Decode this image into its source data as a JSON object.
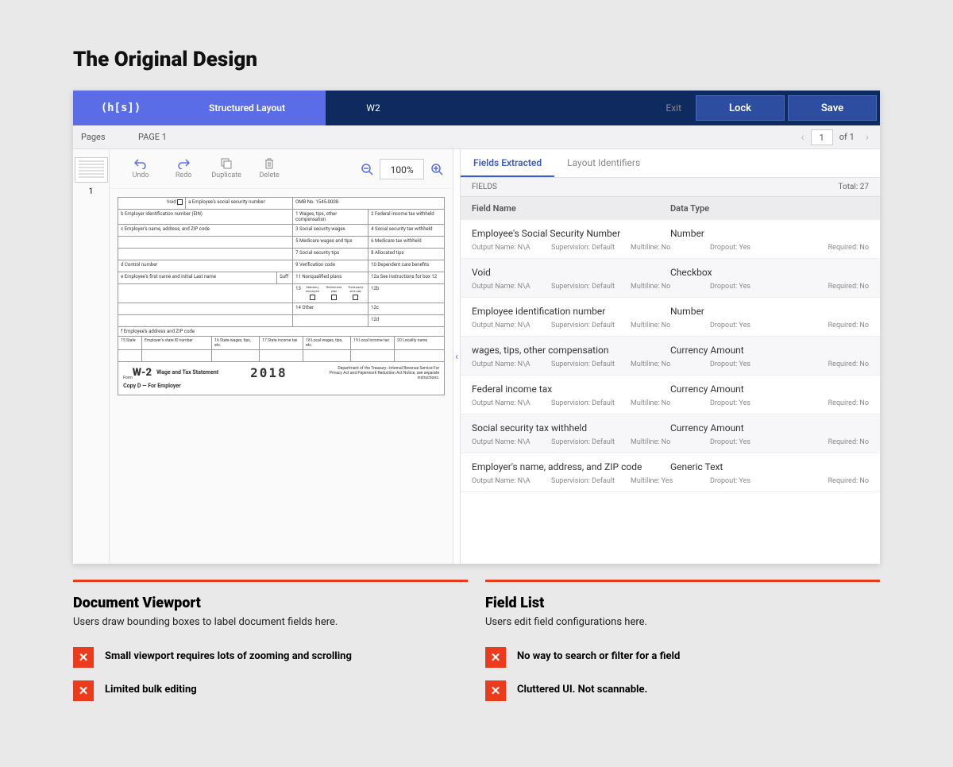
{
  "title": "The Original Design",
  "header": {
    "logo": "(h[s])",
    "tab_sl": "Structured Layout",
    "tab_w2": "W2",
    "exit": "Exit",
    "lock": "Lock",
    "save": "Save"
  },
  "subheader": {
    "pages": "Pages",
    "page1": "PAGE 1",
    "page_num": "1",
    "of": "of 1"
  },
  "sidebar": {
    "thumb_num": "1"
  },
  "toolbar": {
    "undo": "Undo",
    "redo": "Redo",
    "duplicate": "Duplicate",
    "delete": "Delete",
    "zoom": "100%"
  },
  "w2": {
    "void": "Void",
    "a": "a  Employee's social security number",
    "omb": "OMB No. 1545-0008",
    "b": "b  Employer identification number (EIN)",
    "c": "c  Employer's name, address, and ZIP code",
    "d": "d  Control number",
    "e": "e  Employee's first name and initial    Last name",
    "suff": "Suff",
    "f": "f  Employee's address and ZIP code",
    "box1": "1  Wages, tips, other compensation",
    "box2": "2  Federal income tax withheld",
    "box3": "3  Social security wages",
    "box4": "4  Social security tax withheld",
    "box5": "5  Medicare wages and tips",
    "box6": "6  Medicare tax withheld",
    "box7": "7  Social security tips",
    "box8": "8  Allocated tips",
    "box9": "9  Verification code",
    "box10": "10  Dependent care benefits",
    "box11": "11  Nonqualified plans",
    "box12a": "12a  See instructions for box 12",
    "box12b": "12b",
    "box12c": "12c",
    "box12d": "12d",
    "box13a": "Statutory employee",
    "box13b": "Retirement plan",
    "box13c": "Third-party sick pay",
    "box13": "13",
    "box14": "14  Other",
    "box15": "15  State",
    "box15b": "Employer's state ID number",
    "box16": "16  State wages, tips, etc.",
    "box17": "17  State income tax",
    "box18": "18  Local wages, tips, etc.",
    "box19": "19  Local income tax",
    "box20": "20  Locality name",
    "form_small": "Form",
    "form": "W-2",
    "stmt": "Wage and Tax\nStatement",
    "year": "2018",
    "dept": "Department of the Treasury—Internal Revenue Service\nFor Privacy Act and Paperwork Reduction\nAct Notice, see separate instructions.",
    "copy": "Copy D — For Employer"
  },
  "panel": {
    "tab_fields": "Fields Extracted",
    "tab_layout": "Layout Identifiers",
    "fields_label": "FIELDS",
    "total": "Total: 27",
    "col_name": "Field Name",
    "col_type": "Data Type",
    "out_lbl": "Output Name:",
    "sup_lbl": "Supervision:",
    "mul_lbl": "Multiline:",
    "drop_lbl": "Dropout:",
    "req_lbl": "Required:",
    "rows": [
      {
        "name": "Employee's Social Security Number",
        "type": "Number",
        "out": "N\\A",
        "sup": "Default",
        "mul": "No",
        "drop": "Yes",
        "req": "No"
      },
      {
        "name": "Void",
        "type": "Checkbox",
        "out": "N\\A",
        "sup": "Default",
        "mul": "No",
        "drop": "Yes",
        "req": "No"
      },
      {
        "name": "Employee identification number",
        "type": "Number",
        "out": "N\\A",
        "sup": "Default",
        "mul": "No",
        "drop": "Yes",
        "req": "No"
      },
      {
        "name": "wages, tips, other compensation",
        "type": "Currency Amount",
        "out": "N\\A",
        "sup": "Default",
        "mul": "No",
        "drop": "Yes",
        "req": "No"
      },
      {
        "name": "Federal income tax",
        "type": "Currency Amount",
        "out": "N\\A",
        "sup": "Default",
        "mul": "No",
        "drop": "Yes",
        "req": "No"
      },
      {
        "name": "Social security tax withheld",
        "type": "Currency Amount",
        "out": "N\\A",
        "sup": "Default",
        "mul": "No",
        "drop": "Yes",
        "req": "No"
      },
      {
        "name": "Employer's name, address, and ZIP code",
        "type": "Generic Text",
        "out": "N\\A",
        "sup": "Default",
        "mul": "Yes",
        "drop": "Yes",
        "req": "No"
      }
    ]
  },
  "annotations": {
    "left": {
      "title": "Document Viewport",
      "sub": "Users draw bounding boxes to label document fields here.",
      "issues": [
        "Small viewport requires lots of zooming and scrolling",
        "Limited bulk editing"
      ]
    },
    "right": {
      "title": "Field List",
      "sub": "Users edit field configurations here.",
      "issues": [
        "No way to search or filter for a field",
        "Cluttered UI. Not scannable."
      ]
    }
  }
}
